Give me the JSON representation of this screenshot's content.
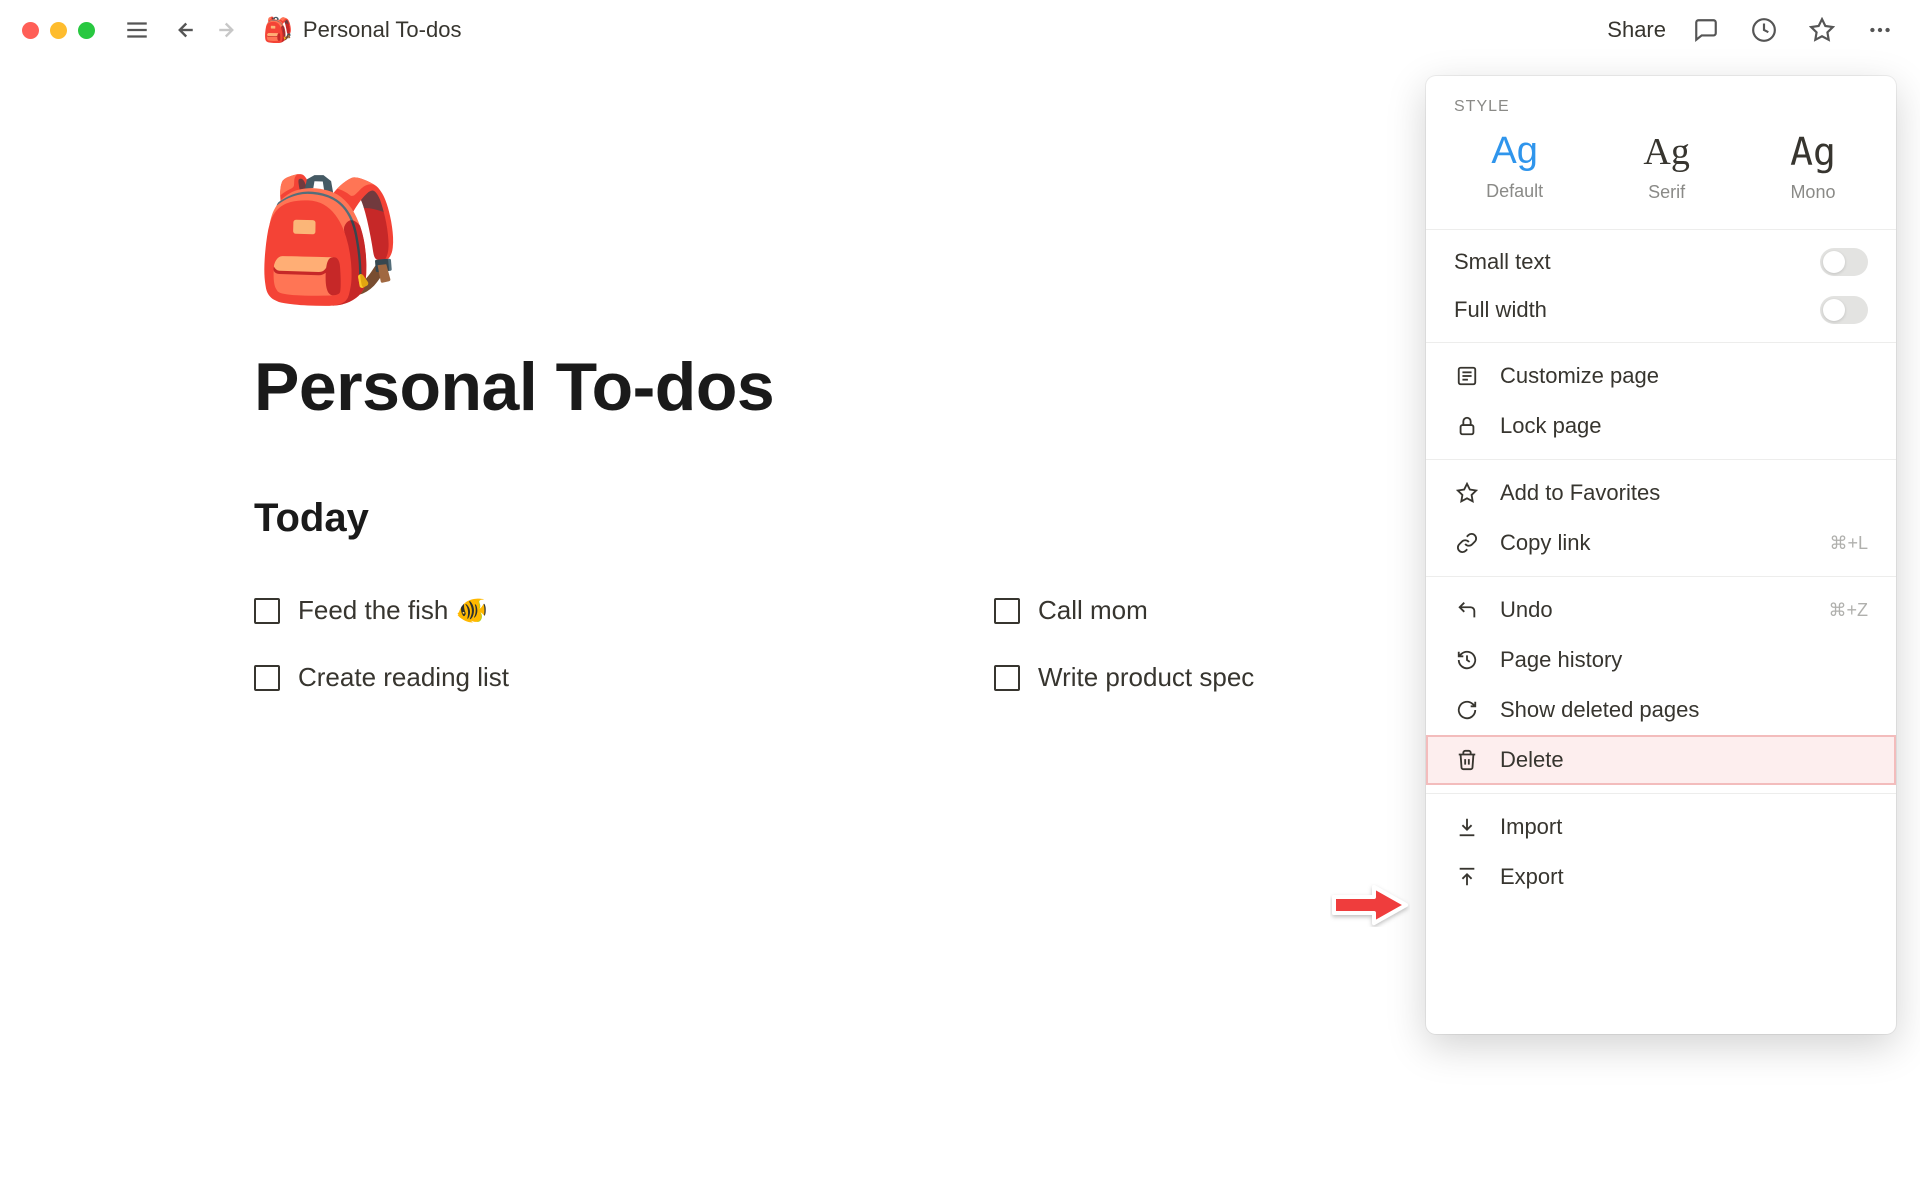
{
  "breadcrumb": {
    "emoji": "🎒",
    "title": "Personal To-dos"
  },
  "topbar": {
    "share_label": "Share"
  },
  "page": {
    "emoji": "🎒",
    "title": "Personal To-dos",
    "section": "Today"
  },
  "todos": [
    {
      "label": "Feed the fish 🐠"
    },
    {
      "label": "Call mom"
    },
    {
      "label": "Create reading list"
    },
    {
      "label": "Write product spec"
    }
  ],
  "popover": {
    "style_header": "STYLE",
    "styles": [
      {
        "ag": "Ag",
        "name": "Default",
        "selected": true
      },
      {
        "ag": "Ag",
        "name": "Serif",
        "selected": false
      },
      {
        "ag": "Ag",
        "name": "Mono",
        "selected": false
      }
    ],
    "toggles": {
      "small_text": "Small text",
      "full_width": "Full width"
    },
    "items": {
      "customize": "Customize page",
      "lock": "Lock page",
      "favorites": "Add to Favorites",
      "copy_link": "Copy link",
      "copy_link_shortcut": "⌘+L",
      "undo": "Undo",
      "undo_shortcut": "⌘+Z",
      "history": "Page history",
      "deleted": "Show deleted pages",
      "delete": "Delete",
      "import": "Import",
      "export": "Export"
    }
  }
}
